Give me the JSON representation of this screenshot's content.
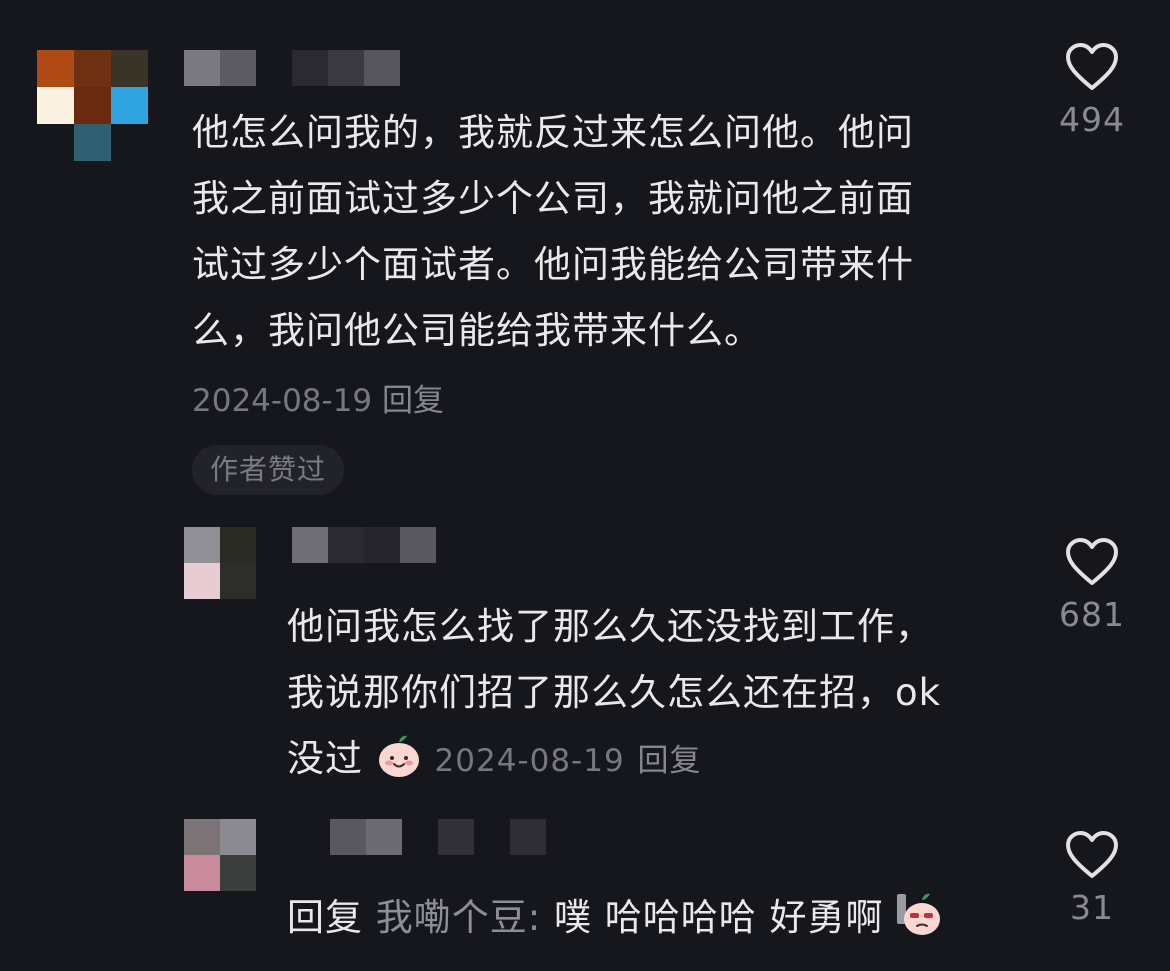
{
  "comments": [
    {
      "text_lines": [
        "他怎么问我的，我就反过来怎么问他。他问",
        "我之前面试过多少个公司，我就问他之前面",
        "试过多少个面试者。他问我能给公司带来什",
        "么，我问他公司能给我带来什么。"
      ],
      "date": "2024-08-19",
      "reply_label": "回复",
      "badge": "作者赞过",
      "like_count": "494"
    },
    {
      "text_lines": [
        "他问我怎么找了那么久还没找到工作，",
        "我说那你们招了那么久怎么还在招，ok",
        "没过"
      ],
      "date": "2024-08-19",
      "reply_label": "回复",
      "like_count": "681"
    },
    {
      "reply_prefix": "回复",
      "reply_target": "我嘞个豆:",
      "text": "噗 哈哈哈哈 好勇啊",
      "like_count": "31"
    }
  ],
  "colors": {
    "background": "#16161d",
    "text": "#e9e9ec",
    "muted": "#77777f"
  },
  "icons": [
    "heart-outline-icon",
    "peach-smile-emoji-icon",
    "peach-cool-emoji-icon"
  ]
}
